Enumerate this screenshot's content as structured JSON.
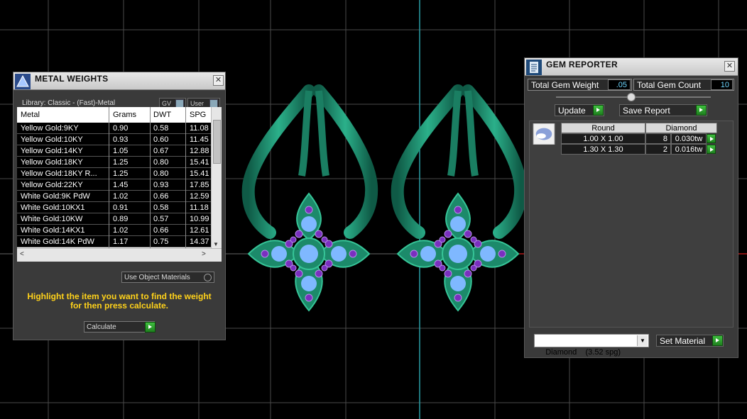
{
  "metal_weights": {
    "title": "METAL WEIGHTS",
    "icon": "pyramid-scale-icon",
    "library_label": "Library: Classic - (Fast)-Metal",
    "toggle_gv": "GV",
    "toggle_user": "User",
    "columns": [
      "Metal",
      "Grams",
      "DWT",
      "SPG"
    ],
    "rows": [
      [
        "Yellow Gold:9KY",
        "0.90",
        "0.58",
        "11.08"
      ],
      [
        "Yellow Gold:10KY",
        "0.93",
        "0.60",
        "11.45"
      ],
      [
        "Yellow Gold:14KY",
        "1.05",
        "0.67",
        "12.88"
      ],
      [
        "Yellow Gold:18KY",
        "1.25",
        "0.80",
        "15.41"
      ],
      [
        "Yellow Gold:18KY R...",
        "1.25",
        "0.80",
        "15.41"
      ],
      [
        "Yellow Gold:22KY",
        "1.45",
        "0.93",
        "17.85"
      ],
      [
        "White Gold:9K PdW",
        "1.02",
        "0.66",
        "12.59"
      ],
      [
        "White Gold:10KX1",
        "0.91",
        "0.58",
        "11.18"
      ],
      [
        "White Gold:10KW",
        "0.89",
        "0.57",
        "10.99"
      ],
      [
        "White Gold:14KX1",
        "1.02",
        "0.66",
        "12.61"
      ],
      [
        "White Gold:14K PdW",
        "1.17",
        "0.75",
        "14.37"
      ]
    ],
    "use_object_materials": "Use Object Materials",
    "hint_line1": "Highlight the item you want to find the weight",
    "hint_line2": "for then press calculate.",
    "calculate_label": "Calculate"
  },
  "gem_reporter": {
    "title": "GEM REPORTER",
    "icon": "report-list-icon",
    "total_weight_label": "Total Gem Weight",
    "total_weight_value": ".05",
    "total_count_label": "Total Gem Count",
    "total_count_value": "10",
    "update_label": "Update",
    "save_report_label": "Save Report",
    "table_header": [
      "Round",
      "Diamond"
    ],
    "gem_rows": [
      {
        "size": "1.00 X 1.00",
        "count": "8",
        "weight": "0.030tw"
      },
      {
        "size": "1.30 X 1.30",
        "count": "2",
        "weight": "0.016tw"
      }
    ],
    "material_select": "Diamond    (3.52 spg)",
    "set_material_label": "Set Material"
  },
  "colors": {
    "metal_green": "#1f8f6e",
    "amethyst": "#7a2fbf",
    "topaz": "#7fb8ff",
    "hint_yellow": "#ffd21a",
    "value_cyan": "#6fd7ff"
  }
}
